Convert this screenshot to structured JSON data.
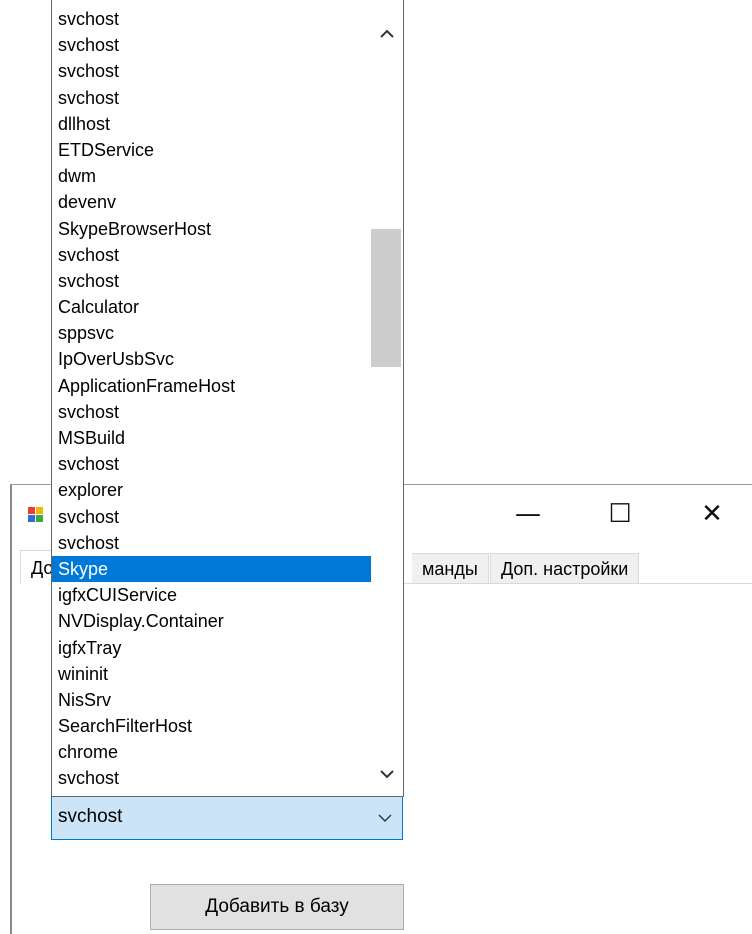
{
  "window": {
    "controls": {
      "minimize_glyph": "—",
      "maximize_glyph": "☐",
      "close_glyph": "✕"
    },
    "tabs": [
      {
        "label": "До",
        "active": true
      },
      {
        "label": "манды",
        "active": false
      },
      {
        "label": "Доп. настройки",
        "active": false
      }
    ]
  },
  "dropdown": {
    "items": [
      "svchost",
      "svchost",
      "svchost",
      "svchost",
      "dllhost",
      "ETDService",
      "dwm",
      "devenv",
      "SkypeBrowserHost",
      "svchost",
      "svchost",
      "Calculator",
      "sppsvc",
      "IpOverUsbSvc",
      "ApplicationFrameHost",
      "svchost",
      "MSBuild",
      "svchost",
      "explorer",
      "svchost",
      "svchost",
      "Skype",
      "igfxCUIService",
      "NVDisplay.Container",
      "igfxTray",
      "wininit",
      "NisSrv",
      "SearchFilterHost",
      "chrome",
      "svchost"
    ],
    "selected_item": "Skype"
  },
  "combo": {
    "value": "svchost"
  },
  "add_button_label": "Добавить в базу",
  "colors": {
    "selection": "#0078d7",
    "combo_background": "#cce4f7",
    "scroll_thumb": "#cdcdcd",
    "button_face": "#e1e1e1"
  },
  "icons": {
    "app": "app-window-icon",
    "scroll_up": "chevron-up-icon",
    "scroll_down": "chevron-down-icon",
    "combo_arrow": "chevron-down-icon"
  }
}
